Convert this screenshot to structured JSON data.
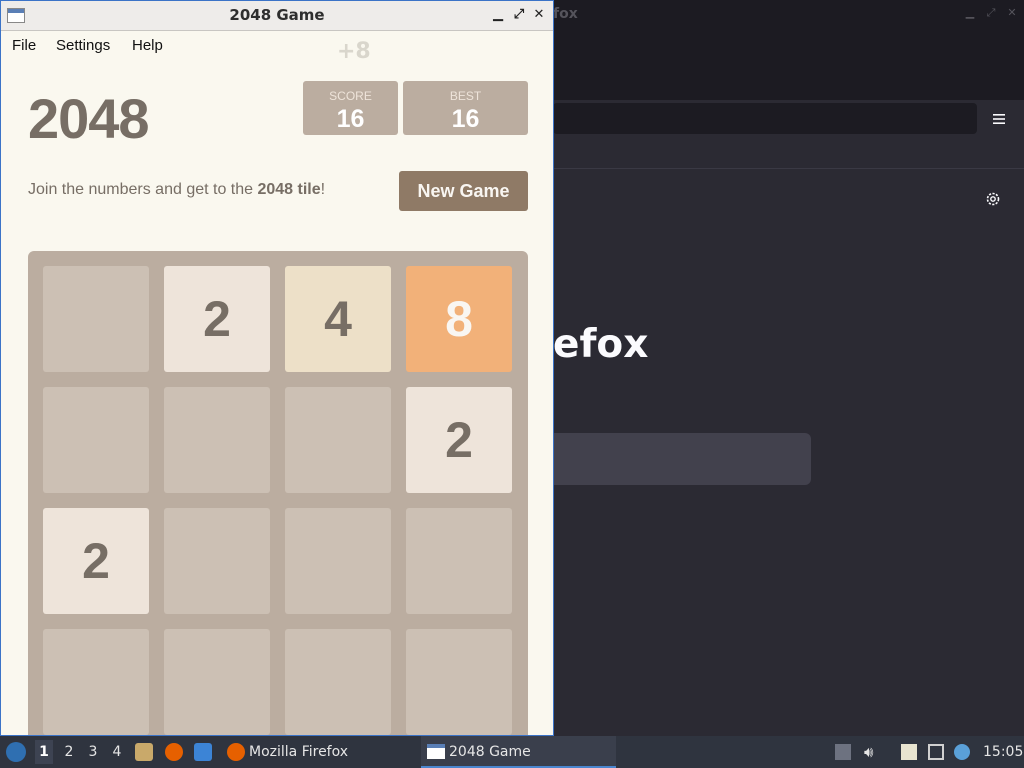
{
  "firefox": {
    "title_fragment": "fox",
    "brand_fragment": "efox"
  },
  "game_window": {
    "title": "2048 Game",
    "menu": [
      "File",
      "Settings",
      "Help"
    ]
  },
  "game": {
    "title": "2048",
    "score_popup": "+8",
    "score_label": "SCORE",
    "score_value": "16",
    "best_label": "BEST",
    "best_value": "16",
    "intro_prefix": "Join the numbers and get to the ",
    "intro_bold": "2048 tile",
    "intro_suffix": "!",
    "new_game_label": "New Game",
    "grid": [
      [
        "",
        "2",
        "4",
        "8"
      ],
      [
        "",
        "",
        "",
        "2"
      ],
      [
        "2",
        "",
        "",
        ""
      ],
      [
        "",
        "",
        "",
        ""
      ]
    ],
    "tile_colors": {
      "2": "#eee4da",
      "4": "#ede0c8",
      "8": "#f2b179"
    }
  },
  "taskbar": {
    "workspaces": [
      "1",
      "2",
      "3",
      "4"
    ],
    "tasks": [
      {
        "label": "Mozilla Firefox",
        "icon": "firefox-icon"
      },
      {
        "label": "2048 Game",
        "icon": "window-icon"
      }
    ],
    "clock": "15:05"
  }
}
